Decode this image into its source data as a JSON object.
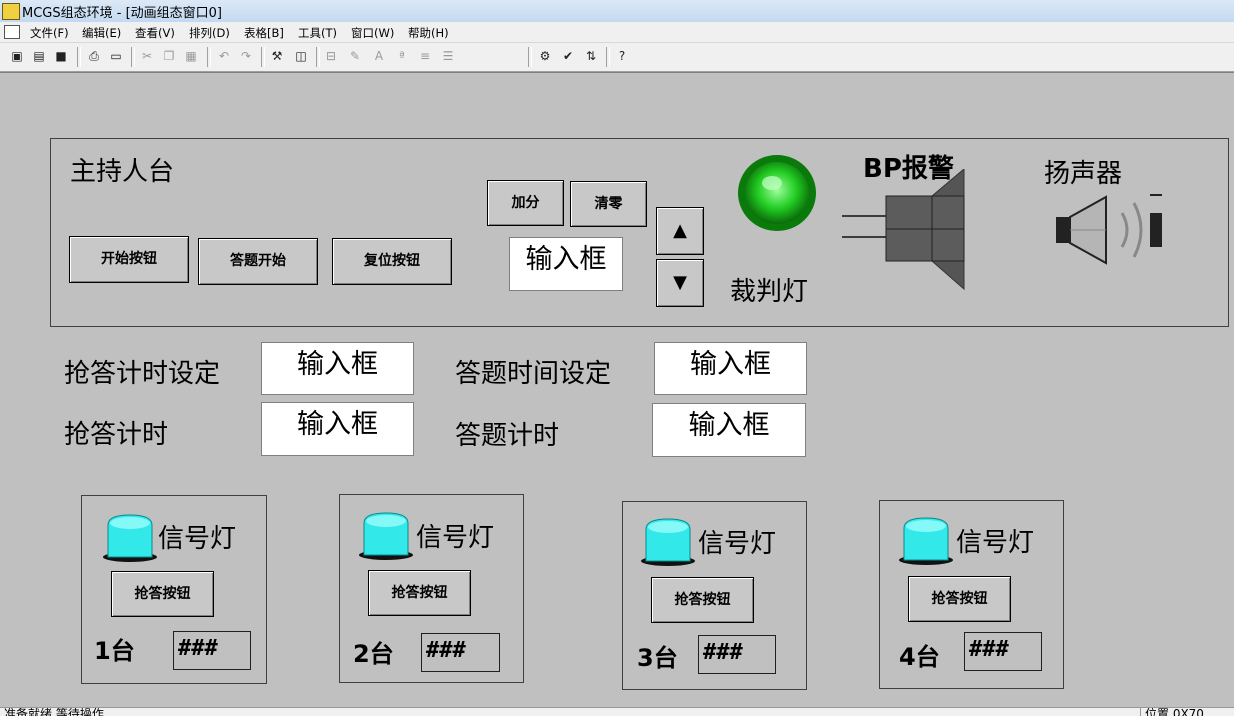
{
  "window": {
    "title": "MCGS组态环境 - [动画组态窗口0]"
  },
  "menu": [
    "文件(F)",
    "编辑(E)",
    "查看(V)",
    "排列(D)",
    "表格[B]",
    "工具(T)",
    "窗口(W)",
    "帮助(H)"
  ],
  "toolbar": {
    "icons": [
      "new-window-icon",
      "open-icon",
      "save-icon",
      "print-icon",
      "print-preview-icon",
      "cut-icon",
      "copy-icon",
      "paste-icon",
      "undo-icon",
      "redo-icon",
      "tools-icon",
      "frame-icon",
      "align-icon",
      "edit-icon",
      "text-icon",
      "font-icon",
      "lines-icon",
      "fill-icon",
      "properties-icon",
      "check-icon",
      "list-icon",
      "help-icon"
    ]
  },
  "host_panel": {
    "title": "主持人台",
    "start_button": "开始按钮",
    "answer_start_button": "答题开始",
    "reset_button": "复位按钮",
    "add_score_button": "加分",
    "clear_button": "清零",
    "score_input": "输入框",
    "up_arrow": "▲",
    "down_arrow": "▼",
    "judge_light_label": "裁判灯",
    "judge_light_color": "#22cc22",
    "bp_alarm_label": "BP报警",
    "speaker_label": "扬声器"
  },
  "settings": {
    "rush_timer_setting_label": "抢答计时设定",
    "rush_timer_setting_value": "输入框",
    "answer_time_setting_label": "答题时间设定",
    "answer_time_setting_value": "输入框",
    "rush_timer_label": "抢答计时",
    "rush_timer_value": "输入框",
    "answer_timer_label": "答题计时",
    "answer_timer_value": "输入框"
  },
  "stations": [
    {
      "light_label": "信号灯",
      "button": "抢答按钮",
      "name": "1台",
      "score": "###"
    },
    {
      "light_label": "信号灯",
      "button": "抢答按钮",
      "name": "2台",
      "score": "###"
    },
    {
      "light_label": "信号灯",
      "button": "抢答按钮",
      "name": "3台",
      "score": "###"
    },
    {
      "light_label": "信号灯",
      "button": "抢答按钮",
      "name": "4台",
      "score": "###"
    }
  ],
  "signal_light_color": "#33e8e8",
  "status": {
    "text": "准备就绪,等待操作",
    "position": "位置 0X70"
  }
}
